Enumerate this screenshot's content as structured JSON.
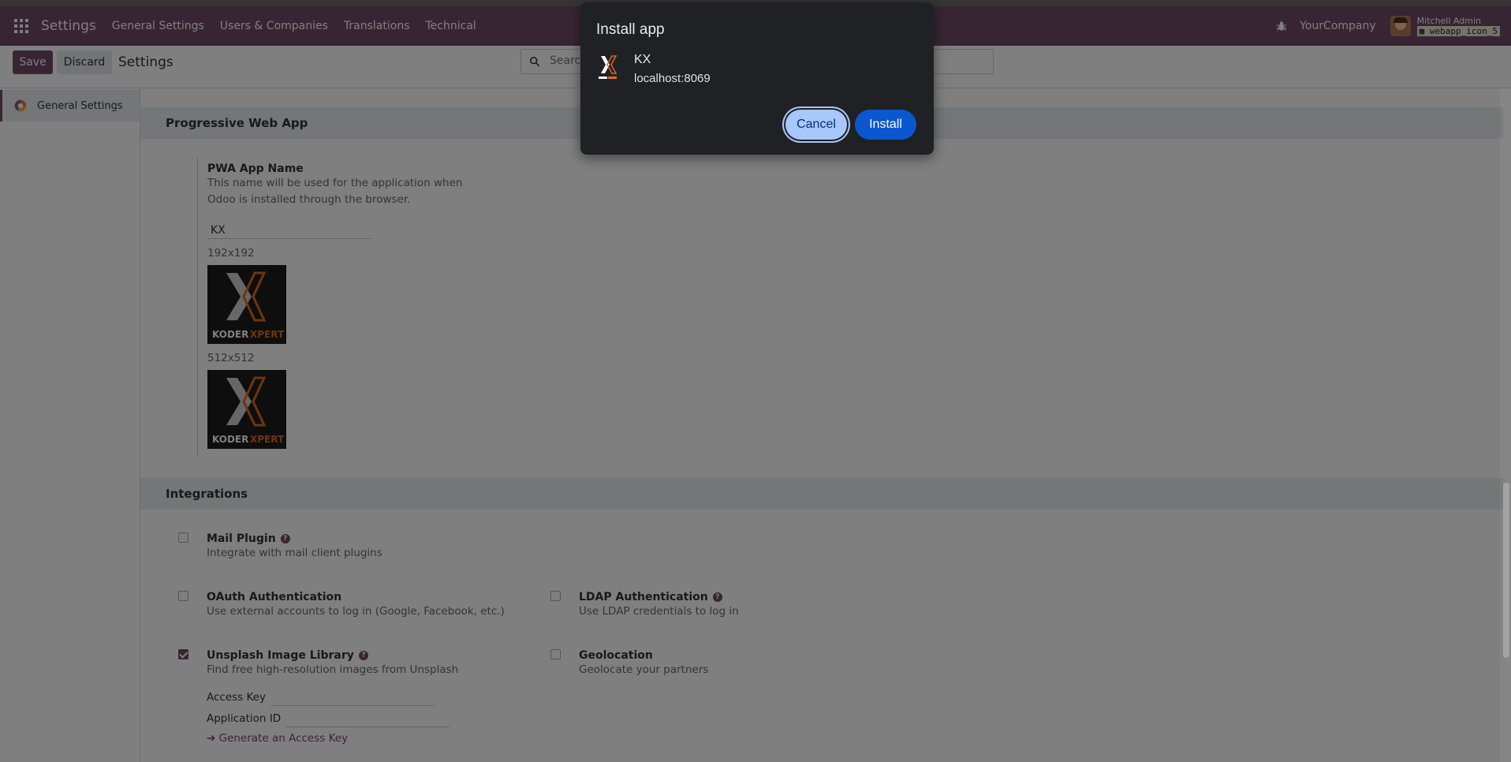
{
  "navbar": {
    "app_name": "Settings",
    "menu": [
      "General Settings",
      "Users & Companies",
      "Translations",
      "Technical"
    ],
    "company": "YourCompany",
    "user_name": "Mitchell Admin",
    "db_name": "webapp_icon_5"
  },
  "control": {
    "save_label": "Save",
    "discard_label": "Discard",
    "title": "Settings",
    "search_placeholder": "Search..."
  },
  "sidebar": {
    "items": [
      {
        "label": "General Settings"
      }
    ]
  },
  "pwa": {
    "section_title": "Progressive Web App",
    "app_name_label": "PWA App Name",
    "app_name_help": "This name will be used for the application when Odoo is installed through the browser.",
    "app_name_value": "KX",
    "icon_192_label": "192x192",
    "icon_512_label": "512x512",
    "logo_text_a": "KODER",
    "logo_text_b": "XPERT"
  },
  "integrations": {
    "section_title": "Integrations",
    "mail_plugin": {
      "title": "Mail Plugin",
      "desc": "Integrate with mail client plugins",
      "checked": false
    },
    "oauth": {
      "title": "OAuth Authentication",
      "desc": "Use external accounts to log in (Google, Facebook, etc.)",
      "checked": false
    },
    "ldap": {
      "title": "LDAP Authentication",
      "desc": "Use LDAP credentials to log in",
      "checked": false
    },
    "unsplash": {
      "title": "Unsplash Image Library",
      "desc": "Find free high-resolution images from Unsplash",
      "checked": true,
      "access_key_label": "Access Key",
      "app_id_label": "Application ID",
      "generate_link": "Generate an Access Key"
    },
    "geolocation": {
      "title": "Geolocation",
      "desc": "Geolocate your partners",
      "checked": false
    }
  },
  "dialog": {
    "title": "Install app",
    "app_name": "KX",
    "origin": "localhost:8069",
    "cancel_label": "Cancel",
    "install_label": "Install"
  },
  "colors": {
    "brand": "#714b67",
    "dialog_bg": "#202124",
    "install_button": "#0b57d0",
    "cancel_button": "#a8c7fa"
  }
}
